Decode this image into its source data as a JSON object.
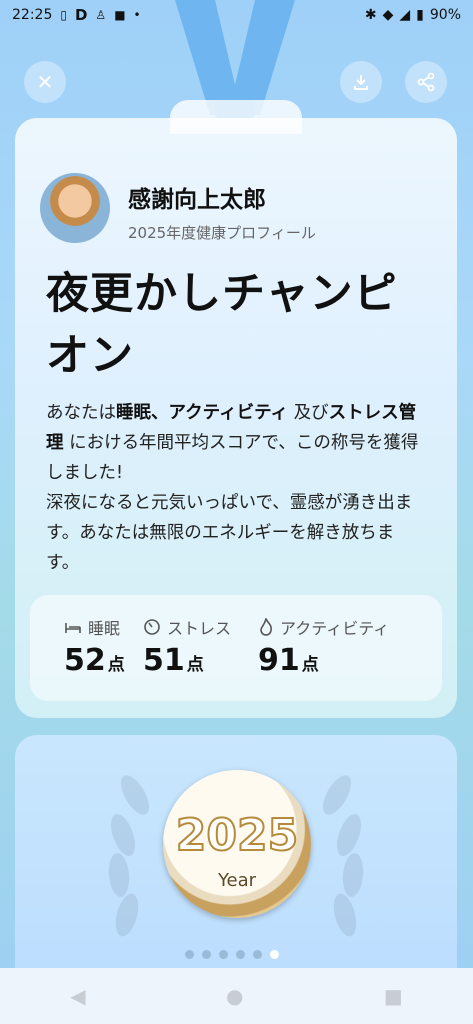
{
  "status_bar": {
    "time": "22:25",
    "battery": "90%"
  },
  "profile": {
    "name": "感謝向上太郎",
    "subtitle": "2025年度健康プロフィール"
  },
  "title": "夜更かしチャンピオン",
  "description": {
    "p1_prefix": "あなたは",
    "p1_bold1": "睡眠、アクティビティ",
    "p1_mid": " 及び",
    "p1_bold2": "ストレス管理",
    "p1_suffix": " における年間平均スコアで、この称号を獲得しました!",
    "p2": "深夜になると元気いっぱいで、霊感が湧き出ます。あなたは無限のエネルギーを解き放ちます。"
  },
  "stats": [
    {
      "label": "睡眠",
      "value": "52",
      "unit": "点",
      "icon": "bed-icon"
    },
    {
      "label": "ストレス",
      "value": "51",
      "unit": "点",
      "icon": "gauge-icon"
    },
    {
      "label": "アクティビティ",
      "value": "91",
      "unit": "点",
      "icon": "flame-icon"
    }
  ],
  "medal": {
    "year": "2025",
    "sub": "Year"
  },
  "pager": {
    "count": 6,
    "active_index": 5
  },
  "colors": {
    "accent": "#5aa8ec",
    "medal_gold": "#c9a15e"
  }
}
